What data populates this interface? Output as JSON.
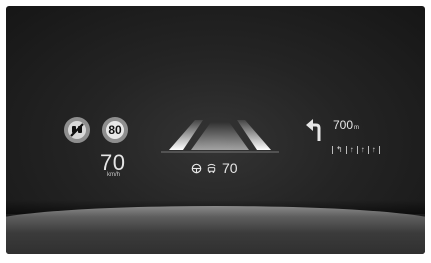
{
  "hud": {
    "left_cluster": {
      "no_overtaking_sign_icon": "no-overtaking-sign",
      "speed_limit_sign": "80",
      "current_speed": "70",
      "speed_unit": "km/h"
    },
    "center": {
      "lane_graphic_icon": "lane-keep-assist-road",
      "steering_assist_icon": "steering-wheel",
      "cruise_icon": "radar-cruise-car",
      "set_speed": "70"
    },
    "navigation": {
      "turn_direction_icon": "turn-left-arrow",
      "distance": "700",
      "distance_unit": "m",
      "lane_guidance": [
        "↰",
        "↑",
        "↑",
        "↑"
      ]
    }
  },
  "colors": {
    "screen_background": "#242424",
    "text": "#e6e6e6",
    "sign_ring": "#8e8e8e"
  }
}
